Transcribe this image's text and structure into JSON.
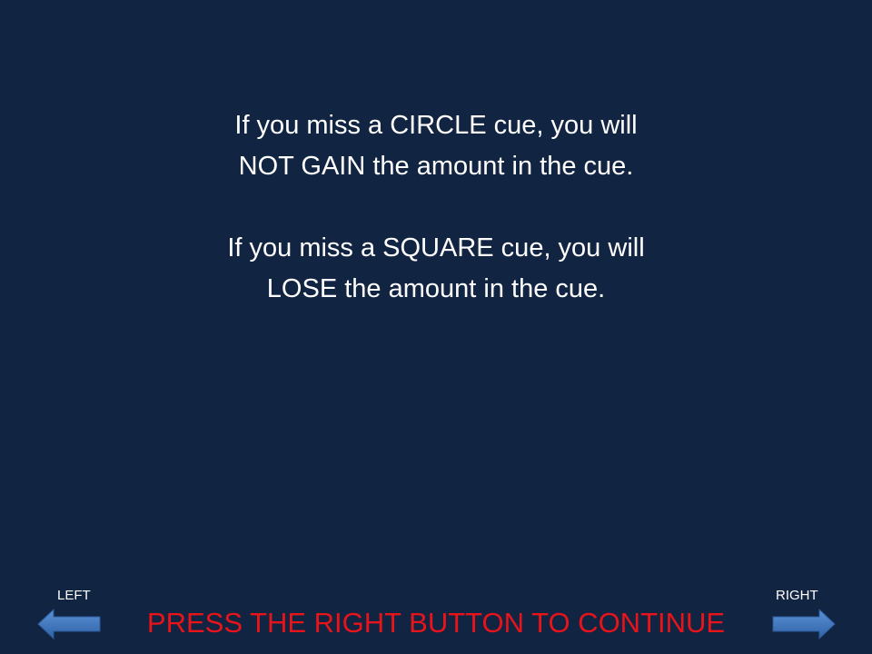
{
  "instructions": {
    "para1": {
      "line1": "If you miss a CIRCLE cue, you will",
      "line2": "NOT GAIN the amount in the cue."
    },
    "para2": {
      "line1": "If you miss a SQUARE cue, you will",
      "line2": "LOSE the amount in the cue."
    }
  },
  "nav": {
    "left_label": "LEFT",
    "right_label": "RIGHT",
    "left_icon": "arrow-left-icon",
    "right_icon": "arrow-right-icon"
  },
  "prompt": {
    "text": "PRESS THE RIGHT BUTTON TO CONTINUE"
  },
  "colors": {
    "background": "#112442",
    "text": "#ffffff",
    "prompt": "#e8141a",
    "arrow": "#3f78c2"
  }
}
